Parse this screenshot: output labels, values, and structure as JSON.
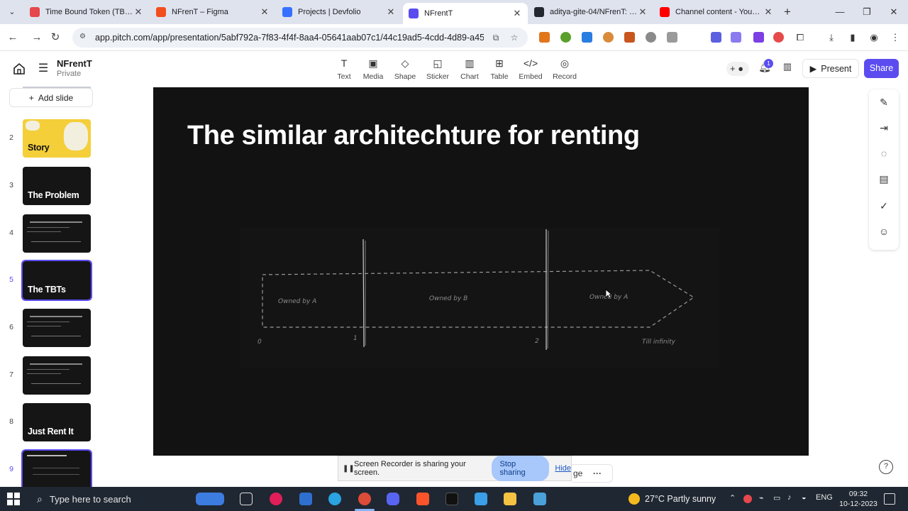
{
  "browser": {
    "tabs": [
      {
        "title": "Time Bound Token (TBT): ",
        "color": "#e5484d",
        "active": false
      },
      {
        "title": "NFrenT – Figma",
        "color": "#f24e1e",
        "active": false
      },
      {
        "title": "Projects | Devfolio",
        "color": "#3770ff",
        "active": false
      },
      {
        "title": "NFrentT",
        "color": "#5b4cf0",
        "active": true
      },
      {
        "title": "aditya-gite-04/NFrenT: Re",
        "color": "#24292f",
        "active": false
      },
      {
        "title": "Channel content - YouTub",
        "color": "#ff0000",
        "active": false
      }
    ],
    "url": "app.pitch.com/app/presentation/5abf792a-7f83-4f4f-8aa4-05641aab07c1/44c19ad5-4cdd-4d89-a45b-256..."
  },
  "header": {
    "doc_title": "NFrentT",
    "doc_subtitle": "Private",
    "tools": [
      {
        "label": "Text",
        "icon": "T"
      },
      {
        "label": "Media",
        "icon": "▣"
      },
      {
        "label": "Shape",
        "icon": "◇"
      },
      {
        "label": "Sticker",
        "icon": "◱"
      },
      {
        "label": "Chart",
        "icon": "▥"
      },
      {
        "label": "Table",
        "icon": "⊞"
      },
      {
        "label": "Embed",
        "icon": "</>"
      },
      {
        "label": "Record",
        "icon": "◎"
      }
    ],
    "notification_count": "1",
    "present_label": "Present",
    "share_label": "Share"
  },
  "sidebar": {
    "add_slide_label": "Add slide",
    "slides": [
      {
        "num": "2",
        "title": "Story",
        "style": "yellow",
        "active": false
      },
      {
        "num": "3",
        "title": "The Problem",
        "style": "dark",
        "active": false
      },
      {
        "num": "4",
        "title": "",
        "style": "text",
        "active": false
      },
      {
        "num": "5",
        "title": "The TBTs",
        "style": "dark",
        "active": true
      },
      {
        "num": "6",
        "title": "",
        "style": "text",
        "active": false
      },
      {
        "num": "7",
        "title": "",
        "style": "text",
        "active": false
      },
      {
        "num": "8",
        "title": "Just Rent It",
        "style": "dark",
        "active": false
      },
      {
        "num": "9",
        "title": "",
        "style": "diagram",
        "active": true
      }
    ]
  },
  "slide": {
    "title": "The similar architechture for renting",
    "diagram": {
      "segment_a": "Owned by A",
      "segment_b": "Owned by B",
      "segment_c": "Owned by A",
      "tick_0": "0",
      "tick_1": "1",
      "tick_2": "2",
      "tick_end": "Till infinity"
    }
  },
  "recorder": {
    "message": "Screen Recorder is sharing your screen.",
    "stop_label": "Stop sharing",
    "hide_label": "Hide",
    "under_text": "ge"
  },
  "taskbar": {
    "search_placeholder": "Type here to search",
    "weather": "27°C  Partly sunny",
    "language": "ENG",
    "time": "09:32",
    "date": "10-12-2023"
  }
}
